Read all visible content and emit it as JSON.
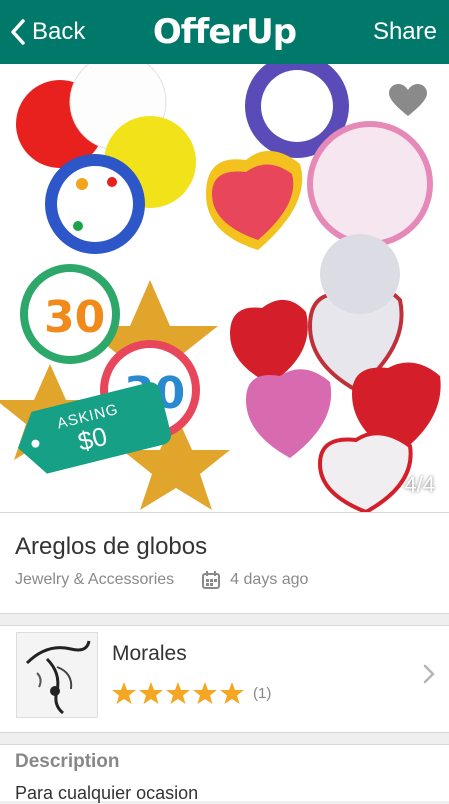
{
  "nav": {
    "back_label": "Back",
    "logo_text": "OfferUp",
    "share_label": "Share"
  },
  "photo": {
    "price_tag_label": "ASKING",
    "price": "$0",
    "image_counter": "4/4"
  },
  "listing": {
    "title": "Areglos de globos",
    "category": "Jewelry & Accessories",
    "posted": "4 days ago"
  },
  "seller": {
    "name": "Morales",
    "rating": 5,
    "review_count": "(1)"
  },
  "description": {
    "heading": "Description",
    "text": "Para cualquier ocasion"
  },
  "colors": {
    "brand": "#00786a",
    "tag": "#16a085",
    "star": "#f5a623"
  }
}
